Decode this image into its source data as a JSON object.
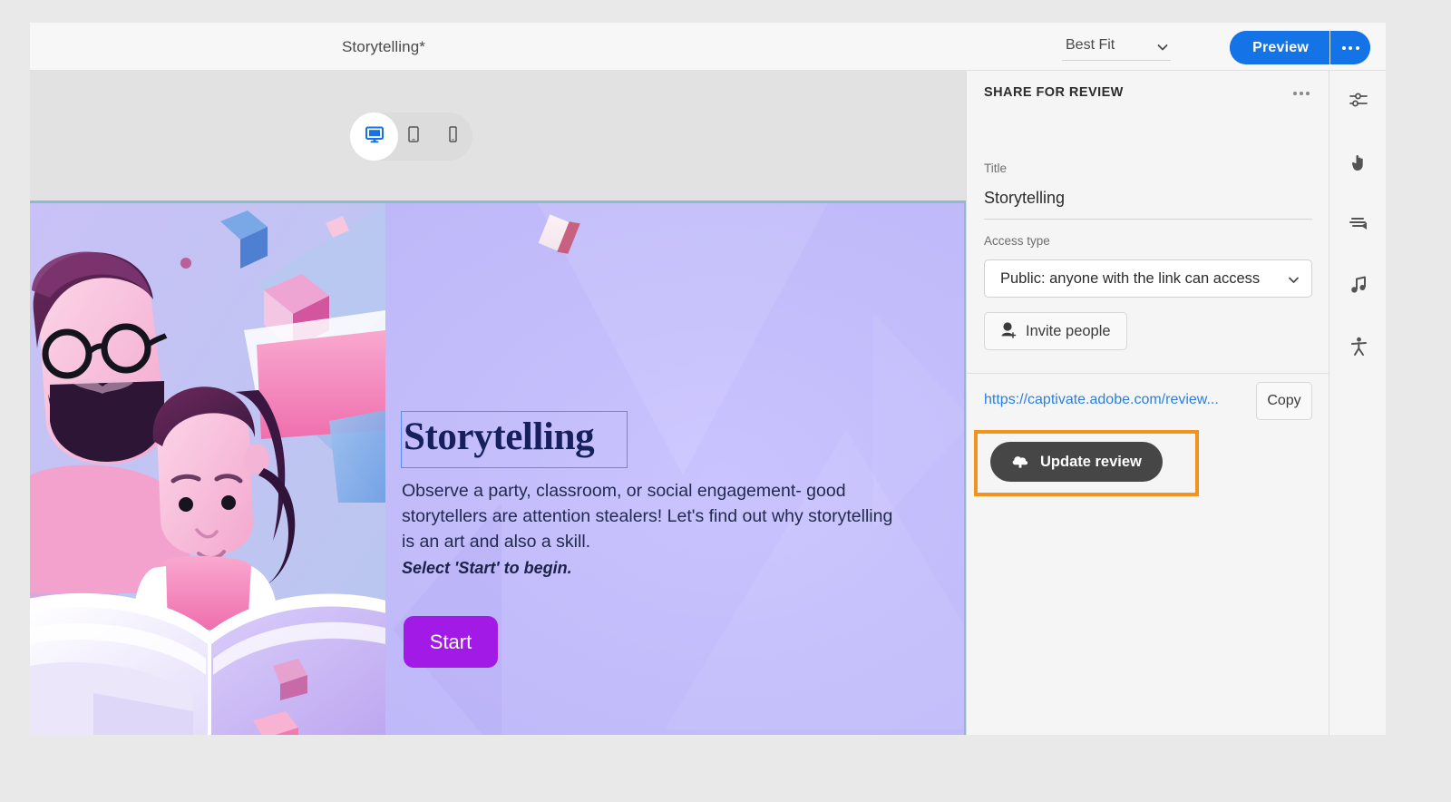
{
  "app": {
    "document_title": "Storytelling*"
  },
  "toolbar": {
    "zoom_level": "Best Fit",
    "zoom_caret_icon": "chevron-down-icon",
    "preview_label": "Preview",
    "preview_more_icon": "more-options-icon",
    "preview_color": "#1473e6"
  },
  "device_toggle": {
    "items": [
      {
        "name": "desktop",
        "icon": "desktop-icon",
        "selected": true
      },
      {
        "name": "tablet",
        "icon": "tablet-icon",
        "selected": false
      },
      {
        "name": "mobile",
        "icon": "mobile-icon",
        "selected": false
      }
    ]
  },
  "slide": {
    "title": "Storytelling",
    "body": "Observe a party, classroom, or social engagement- good storytellers are attention stealers! Let's find out why storytelling is an art and also a skill.",
    "cta_note": "Select 'Start' to begin.",
    "start_button": "Start",
    "start_button_color": "#a21ae6",
    "selection_border_color": "#5b8def",
    "background_color": "#c3bdfb",
    "illustration": "father-and-daughter-reading-book-illustration"
  },
  "panel": {
    "heading": "SHARE FOR REVIEW",
    "more_icon": "more-options-icon",
    "title_label": "Title",
    "title_value": "Storytelling",
    "access_label": "Access type",
    "access_value": "Public: anyone with the link can access",
    "access_caret_icon": "chevron-down-icon",
    "invite_icon": "add-person-icon",
    "invite_label": "Invite people",
    "share_link": "https://captivate.adobe.com/review...",
    "copy_label": "Copy",
    "update_icon": "cloud-upload-icon",
    "update_label": "Update review",
    "update_button_color": "#464646",
    "highlight_color": "#f0941e"
  },
  "rail": {
    "items": [
      {
        "name": "properties",
        "icon": "sliders-icon"
      },
      {
        "name": "interactions",
        "icon": "hand-pointer-icon"
      },
      {
        "name": "effects",
        "icon": "motion-effects-icon"
      },
      {
        "name": "audio",
        "icon": "music-note-icon"
      },
      {
        "name": "accessibility",
        "icon": "accessibility-person-icon"
      }
    ]
  }
}
